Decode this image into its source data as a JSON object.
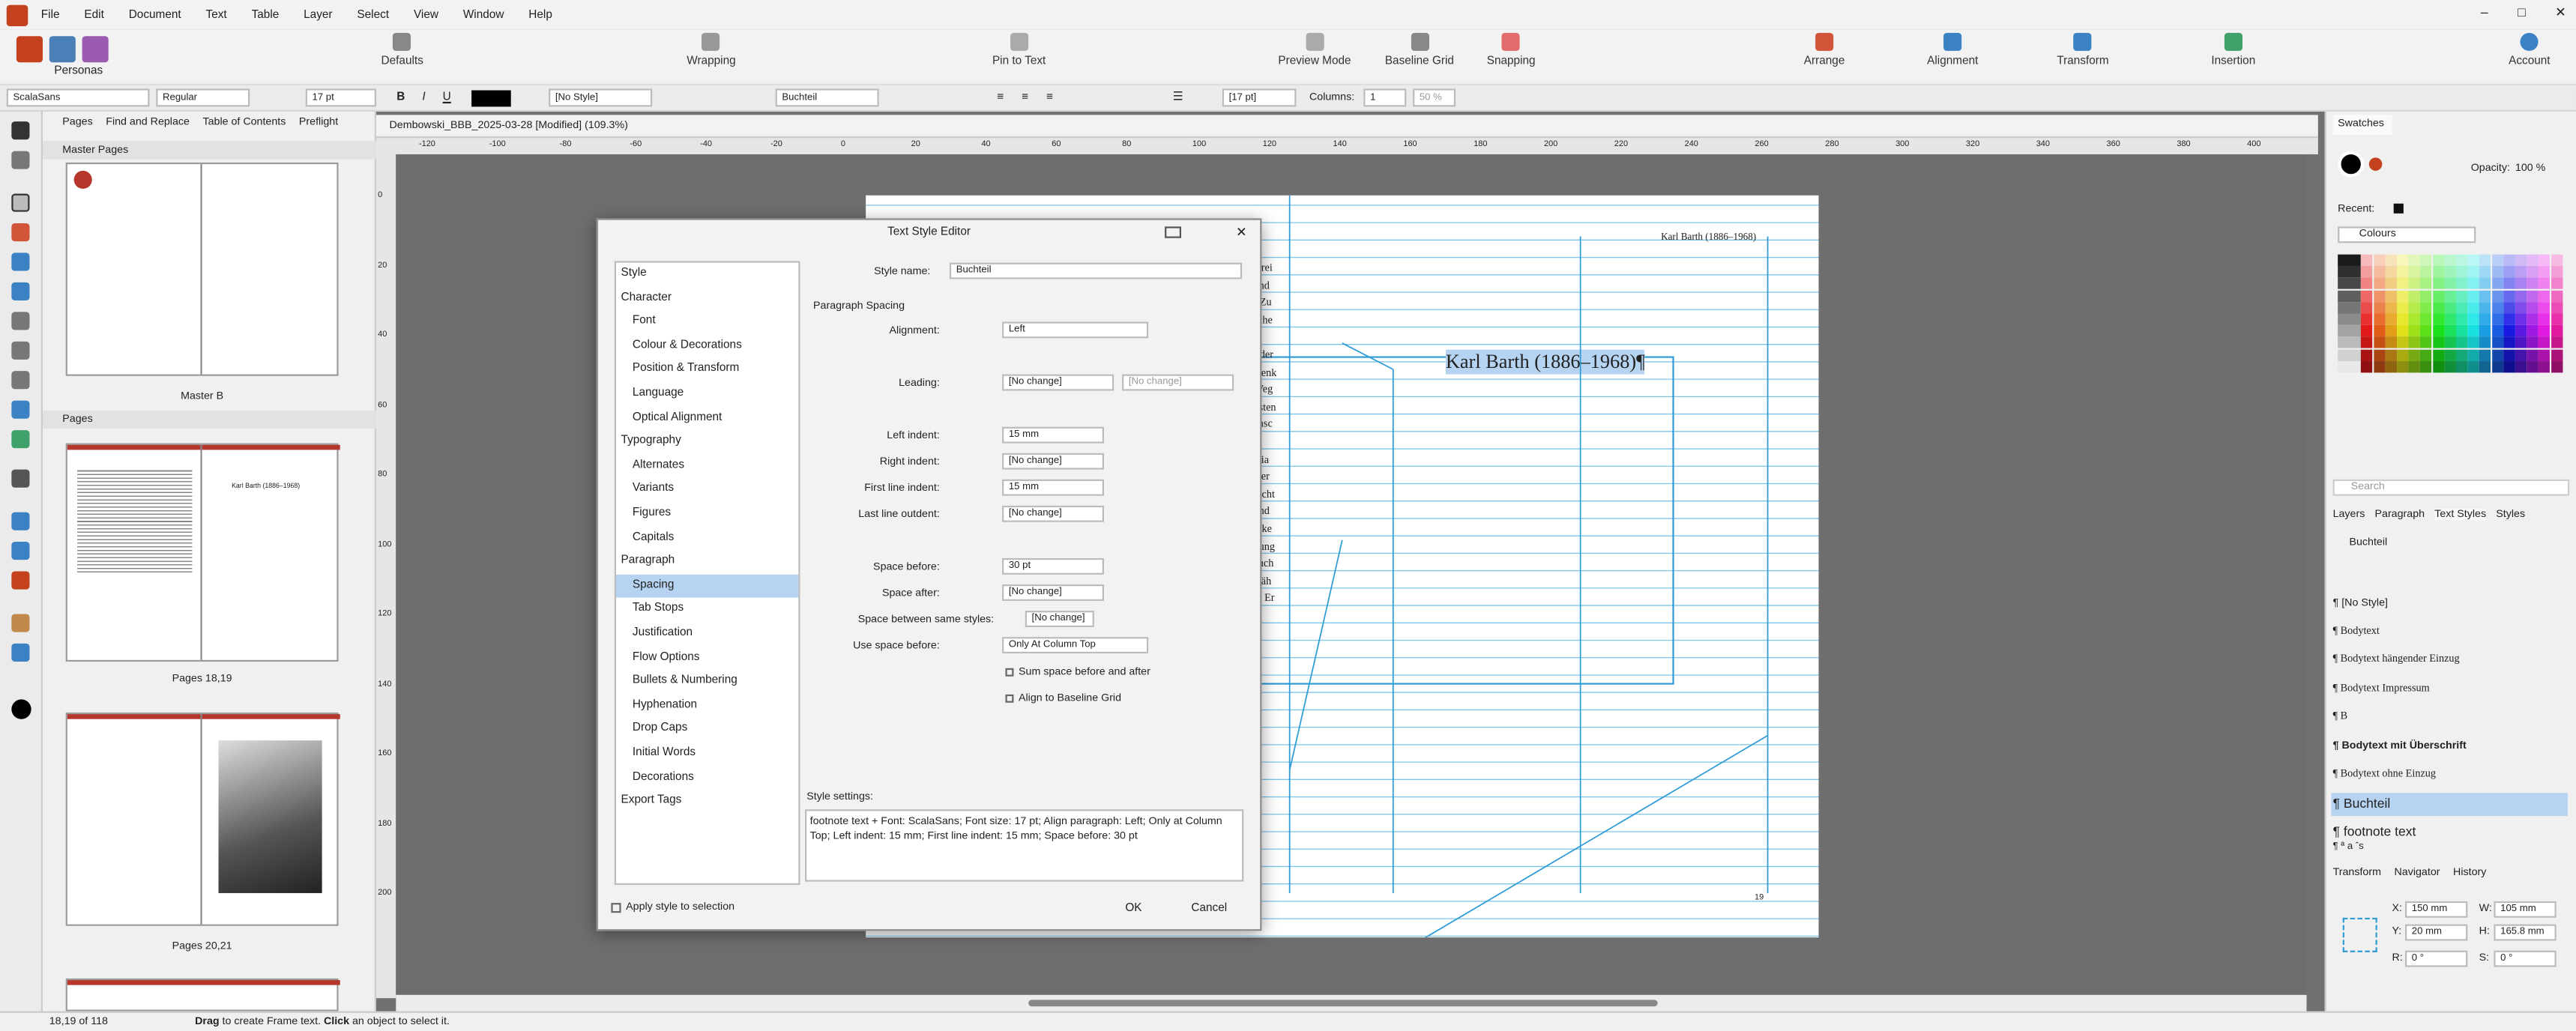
{
  "menubar": {
    "items": [
      "File",
      "Edit",
      "Document",
      "Text",
      "Table",
      "Layer",
      "Select",
      "View",
      "Window",
      "Help"
    ]
  },
  "toolbar": {
    "personas": "Personas",
    "defaults": "Defaults",
    "wrapping": "Wrapping",
    "pin_to_text": "Pin to Text",
    "preview_mode": "Preview Mode",
    "baseline_grid": "Baseline Grid",
    "snapping": "Snapping",
    "arrange": "Arrange",
    "alignment": "Alignment",
    "transform": "Transform",
    "insertion": "Insertion",
    "account": "Account"
  },
  "context": {
    "font_family": "ScalaSans",
    "font_style": "Regular",
    "font_size": "17 pt",
    "char_style": "[No Style]",
    "para_style": "Buchteil",
    "leading": "[17 pt]",
    "columns_label": "Columns:",
    "columns": "1",
    "gutter": "50 %"
  },
  "left": {
    "tabs": [
      "Pages",
      "Find and Replace",
      "Table of Contents",
      "Preflight"
    ],
    "master_pages": "Master Pages",
    "master_caption": "Master B",
    "pages_header": "Pages",
    "spread1_caption": "Pages 18,19",
    "spread2_caption": "Pages 20,21",
    "spread1_heading": "Karl Barth (1886–1968)"
  },
  "document": {
    "tab": "Dembowski_BBB_2025-03-28 [Modified] (109.3%)",
    "ruler_h": [
      "-120",
      "-100",
      "-80",
      "-60",
      "-40",
      "-20",
      "0",
      "20",
      "40",
      "60",
      "80",
      "100",
      "120",
      "140",
      "160",
      "180",
      "200",
      "220",
      "240",
      "260",
      "280",
      "300",
      "320",
      "340",
      "360",
      "380",
      "400"
    ],
    "ruler_v": [
      "0",
      "20",
      "40",
      "60",
      "80",
      "100",
      "120",
      "140",
      "160",
      "180",
      "200"
    ],
    "heading": "Karl Barth (1886–1968)¶",
    "running_head": "Karl Barth (1886–1968)",
    "folio": "19",
    "left_text": [
      "terei",
      "und",
      "r Zu",
      "sche",
      "r der",
      "Denk",
      "Weg",
      "hsten",
      "ensc",
      "Dia",
      "wer",
      "nicht",
      "und",
      "erke",
      "gung",
      "auch",
      "wäh",
      "ar Er"
    ]
  },
  "dialog": {
    "title": "Text Style Editor",
    "list": [
      "Style",
      "Character",
      "Font",
      "Colour & Decorations",
      "Position & Transform",
      "Language",
      "Optical Alignment",
      "Typography",
      "Alternates",
      "Variants",
      "Figures",
      "Capitals",
      "Paragraph",
      "Spacing",
      "Tab Stops",
      "Justification",
      "Flow Options",
      "Bullets & Numbering",
      "Hyphenation",
      "Drop Caps",
      "Initial Words",
      "Decorations",
      "Export Tags"
    ],
    "style_name_label": "Style name:",
    "style_name": "Buchteil",
    "section": "Paragraph Spacing",
    "alignment_label": "Alignment:",
    "alignment": "Left",
    "leading_label": "Leading:",
    "leading": "[No change]",
    "leading2": "[No change]",
    "left_indent_label": "Left indent:",
    "left_indent": "15 mm",
    "right_indent_label": "Right indent:",
    "right_indent": "[No change]",
    "first_line_label": "First line indent:",
    "first_line": "15 mm",
    "last_line_label": "Last line outdent:",
    "last_line": "[No change]",
    "space_before_label": "Space before:",
    "space_before": "30 pt",
    "space_after_label": "Space after:",
    "space_after": "[No change]",
    "same_styles_label": "Space between same styles:",
    "same_styles": "[No change]",
    "use_before_label": "Use space before:",
    "use_before": "Only At Column Top",
    "sum_label": "Sum space before and after",
    "align_label": "Align to Baseline Grid",
    "settings_label": "Style settings:",
    "settings": "footnote text + Font: ScalaSans; Font size: 17 pt; Align paragraph: Left; Only at Column Top; Left indent: 15 mm; First line indent: 15 mm; Space before: 30 pt",
    "apply_label": "Apply style to selection",
    "ok": "OK",
    "cancel": "Cancel"
  },
  "right": {
    "swatches_tab": "Swatches",
    "opacity_label": "Opacity:",
    "opacity": "100 %",
    "recent_label": "Recent:",
    "palette": "Colours",
    "search_placeholder": "Search",
    "tabs": [
      "Layers",
      "Paragraph",
      "Text Styles",
      "Styles"
    ],
    "current_style": "Buchteil",
    "styles": [
      "¶ [No Style]",
      "¶ Bodytext",
      "¶ Bodytext hängender Einzug",
      "¶ Bodytext Impressum",
      "¶ B",
      "¶ Bodytext mit Überschrift",
      "¶ Bodytext ohne Einzug",
      "¶ Buchteil",
      "¶ footnote text"
    ],
    "footnote_sub": "¶ ª a ˆs",
    "t_tabs": [
      "Transform",
      "Navigator",
      "History"
    ],
    "x_label": "X:",
    "x": "150 mm",
    "w_label": "W:",
    "w": "105 mm",
    "y_label": "Y:",
    "y": "20 mm",
    "h_label": "H:",
    "h": "165.8 mm",
    "r_label": "R:",
    "r": "0 °",
    "s_label": "S:",
    "s": "0 °"
  },
  "status": {
    "page": "18,19 of 118",
    "hint_bold1": "Drag",
    "hint1": " to create Frame text. ",
    "hint_bold2": "Click",
    "hint2": " an object to select it."
  },
  "colors": {
    "accent": "#2f9cd6",
    "brand": "#c4411e",
    "selection": "#b6d4f2"
  }
}
